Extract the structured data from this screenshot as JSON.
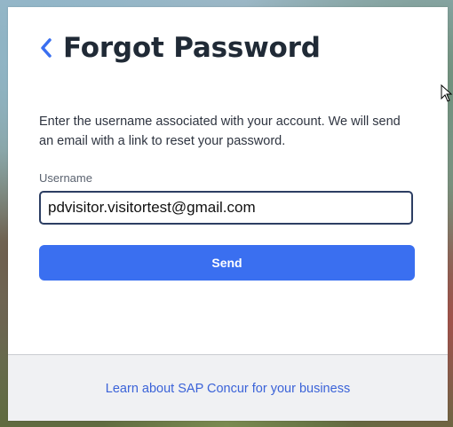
{
  "header": {
    "back_icon": "chevron-left-icon",
    "title": "Forgot Password"
  },
  "form": {
    "description": "Enter the username associated with your account. We will send an email with a link to reset your password.",
    "username_label": "Username",
    "username_value": "pdvisitor.visitortest@gmail.com",
    "send_label": "Send"
  },
  "footer": {
    "link_text": "Learn about SAP Concur for your business"
  },
  "colors": {
    "accent": "#3a6ff0",
    "title": "#202a36",
    "link": "#3b63d8",
    "footer_bg": "#f0f1f3"
  }
}
